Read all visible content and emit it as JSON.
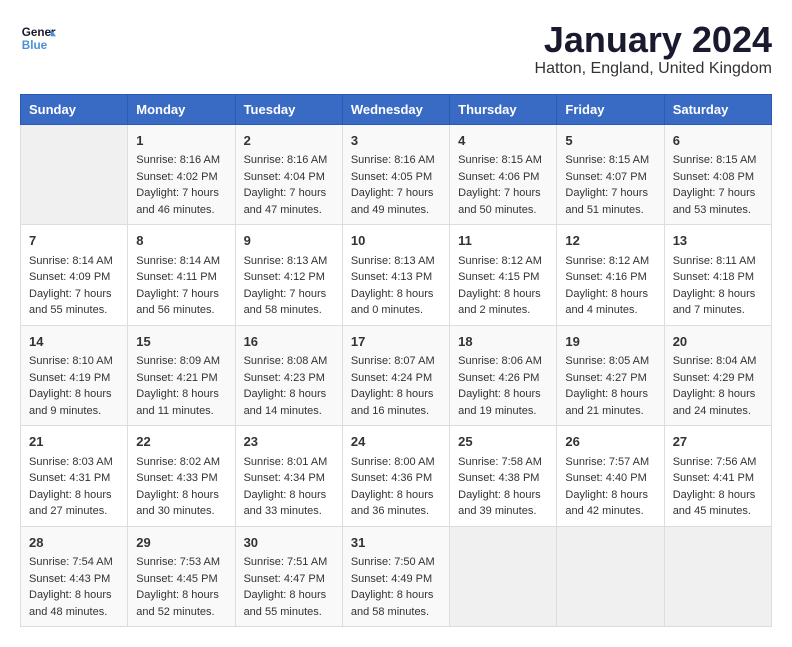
{
  "header": {
    "logo_line1": "General",
    "logo_line2": "Blue",
    "title": "January 2024",
    "subtitle": "Hatton, England, United Kingdom"
  },
  "days_of_week": [
    "Sunday",
    "Monday",
    "Tuesday",
    "Wednesday",
    "Thursday",
    "Friday",
    "Saturday"
  ],
  "weeks": [
    [
      {
        "day": "",
        "sunrise": "",
        "sunset": "",
        "daylight": ""
      },
      {
        "day": "1",
        "sunrise": "Sunrise: 8:16 AM",
        "sunset": "Sunset: 4:02 PM",
        "daylight": "Daylight: 7 hours and 46 minutes."
      },
      {
        "day": "2",
        "sunrise": "Sunrise: 8:16 AM",
        "sunset": "Sunset: 4:04 PM",
        "daylight": "Daylight: 7 hours and 47 minutes."
      },
      {
        "day": "3",
        "sunrise": "Sunrise: 8:16 AM",
        "sunset": "Sunset: 4:05 PM",
        "daylight": "Daylight: 7 hours and 49 minutes."
      },
      {
        "day": "4",
        "sunrise": "Sunrise: 8:15 AM",
        "sunset": "Sunset: 4:06 PM",
        "daylight": "Daylight: 7 hours and 50 minutes."
      },
      {
        "day": "5",
        "sunrise": "Sunrise: 8:15 AM",
        "sunset": "Sunset: 4:07 PM",
        "daylight": "Daylight: 7 hours and 51 minutes."
      },
      {
        "day": "6",
        "sunrise": "Sunrise: 8:15 AM",
        "sunset": "Sunset: 4:08 PM",
        "daylight": "Daylight: 7 hours and 53 minutes."
      }
    ],
    [
      {
        "day": "7",
        "sunrise": "Sunrise: 8:14 AM",
        "sunset": "Sunset: 4:09 PM",
        "daylight": "Daylight: 7 hours and 55 minutes."
      },
      {
        "day": "8",
        "sunrise": "Sunrise: 8:14 AM",
        "sunset": "Sunset: 4:11 PM",
        "daylight": "Daylight: 7 hours and 56 minutes."
      },
      {
        "day": "9",
        "sunrise": "Sunrise: 8:13 AM",
        "sunset": "Sunset: 4:12 PM",
        "daylight": "Daylight: 7 hours and 58 minutes."
      },
      {
        "day": "10",
        "sunrise": "Sunrise: 8:13 AM",
        "sunset": "Sunset: 4:13 PM",
        "daylight": "Daylight: 8 hours and 0 minutes."
      },
      {
        "day": "11",
        "sunrise": "Sunrise: 8:12 AM",
        "sunset": "Sunset: 4:15 PM",
        "daylight": "Daylight: 8 hours and 2 minutes."
      },
      {
        "day": "12",
        "sunrise": "Sunrise: 8:12 AM",
        "sunset": "Sunset: 4:16 PM",
        "daylight": "Daylight: 8 hours and 4 minutes."
      },
      {
        "day": "13",
        "sunrise": "Sunrise: 8:11 AM",
        "sunset": "Sunset: 4:18 PM",
        "daylight": "Daylight: 8 hours and 7 minutes."
      }
    ],
    [
      {
        "day": "14",
        "sunrise": "Sunrise: 8:10 AM",
        "sunset": "Sunset: 4:19 PM",
        "daylight": "Daylight: 8 hours and 9 minutes."
      },
      {
        "day": "15",
        "sunrise": "Sunrise: 8:09 AM",
        "sunset": "Sunset: 4:21 PM",
        "daylight": "Daylight: 8 hours and 11 minutes."
      },
      {
        "day": "16",
        "sunrise": "Sunrise: 8:08 AM",
        "sunset": "Sunset: 4:23 PM",
        "daylight": "Daylight: 8 hours and 14 minutes."
      },
      {
        "day": "17",
        "sunrise": "Sunrise: 8:07 AM",
        "sunset": "Sunset: 4:24 PM",
        "daylight": "Daylight: 8 hours and 16 minutes."
      },
      {
        "day": "18",
        "sunrise": "Sunrise: 8:06 AM",
        "sunset": "Sunset: 4:26 PM",
        "daylight": "Daylight: 8 hours and 19 minutes."
      },
      {
        "day": "19",
        "sunrise": "Sunrise: 8:05 AM",
        "sunset": "Sunset: 4:27 PM",
        "daylight": "Daylight: 8 hours and 21 minutes."
      },
      {
        "day": "20",
        "sunrise": "Sunrise: 8:04 AM",
        "sunset": "Sunset: 4:29 PM",
        "daylight": "Daylight: 8 hours and 24 minutes."
      }
    ],
    [
      {
        "day": "21",
        "sunrise": "Sunrise: 8:03 AM",
        "sunset": "Sunset: 4:31 PM",
        "daylight": "Daylight: 8 hours and 27 minutes."
      },
      {
        "day": "22",
        "sunrise": "Sunrise: 8:02 AM",
        "sunset": "Sunset: 4:33 PM",
        "daylight": "Daylight: 8 hours and 30 minutes."
      },
      {
        "day": "23",
        "sunrise": "Sunrise: 8:01 AM",
        "sunset": "Sunset: 4:34 PM",
        "daylight": "Daylight: 8 hours and 33 minutes."
      },
      {
        "day": "24",
        "sunrise": "Sunrise: 8:00 AM",
        "sunset": "Sunset: 4:36 PM",
        "daylight": "Daylight: 8 hours and 36 minutes."
      },
      {
        "day": "25",
        "sunrise": "Sunrise: 7:58 AM",
        "sunset": "Sunset: 4:38 PM",
        "daylight": "Daylight: 8 hours and 39 minutes."
      },
      {
        "day": "26",
        "sunrise": "Sunrise: 7:57 AM",
        "sunset": "Sunset: 4:40 PM",
        "daylight": "Daylight: 8 hours and 42 minutes."
      },
      {
        "day": "27",
        "sunrise": "Sunrise: 7:56 AM",
        "sunset": "Sunset: 4:41 PM",
        "daylight": "Daylight: 8 hours and 45 minutes."
      }
    ],
    [
      {
        "day": "28",
        "sunrise": "Sunrise: 7:54 AM",
        "sunset": "Sunset: 4:43 PM",
        "daylight": "Daylight: 8 hours and 48 minutes."
      },
      {
        "day": "29",
        "sunrise": "Sunrise: 7:53 AM",
        "sunset": "Sunset: 4:45 PM",
        "daylight": "Daylight: 8 hours and 52 minutes."
      },
      {
        "day": "30",
        "sunrise": "Sunrise: 7:51 AM",
        "sunset": "Sunset: 4:47 PM",
        "daylight": "Daylight: 8 hours and 55 minutes."
      },
      {
        "day": "31",
        "sunrise": "Sunrise: 7:50 AM",
        "sunset": "Sunset: 4:49 PM",
        "daylight": "Daylight: 8 hours and 58 minutes."
      },
      {
        "day": "",
        "sunrise": "",
        "sunset": "",
        "daylight": ""
      },
      {
        "day": "",
        "sunrise": "",
        "sunset": "",
        "daylight": ""
      },
      {
        "day": "",
        "sunrise": "",
        "sunset": "",
        "daylight": ""
      }
    ]
  ]
}
